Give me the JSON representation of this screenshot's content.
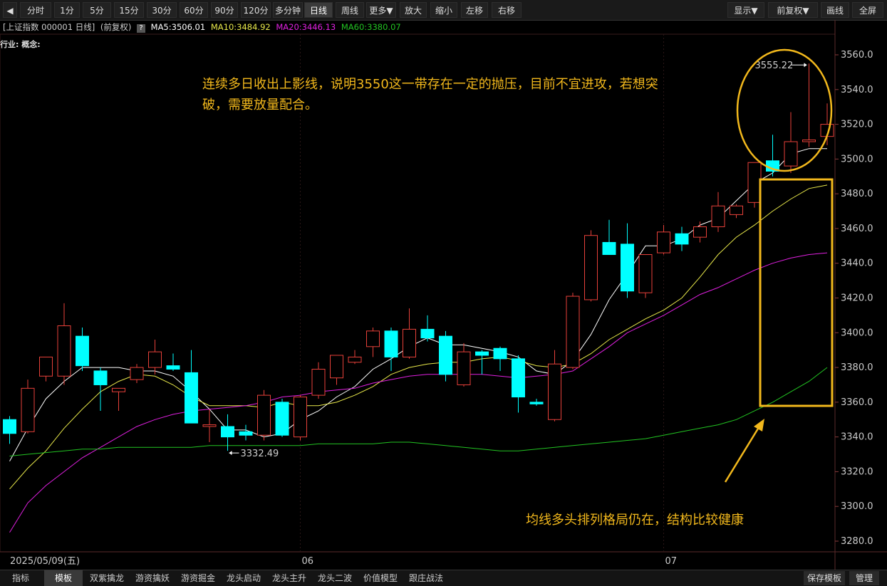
{
  "toolbar": {
    "collapse_icon": "◀",
    "periods": [
      "分时",
      "1分",
      "5分",
      "15分",
      "30分",
      "60分",
      "90分",
      "120分",
      "多分钟",
      "日线",
      "周线",
      "更多▼"
    ],
    "active_period": "日线",
    "zoom_in": "放大",
    "zoom_out": "缩小",
    "left": "左移",
    "right": "右移",
    "display": "显示▼",
    "adjust": "前复权▼",
    "draw": "画线",
    "fullscreen": "全屏"
  },
  "info": {
    "instrument": "[上证指数 000001 日线]",
    "adjust_mode": "(前复权)",
    "help_icon": "?",
    "ma5": "MA5:3506.01",
    "ma10": "MA10:3484.92",
    "ma20": "MA20:3446.13",
    "ma60": "MA60:3380.07",
    "industry": "行业: 概念:"
  },
  "colors": {
    "up": "#e8413a",
    "down": "#00ffff",
    "ma5": "#ffffff",
    "ma10": "#e8e84a",
    "ma20": "#e020e0",
    "ma60": "#22c422",
    "annotation": "#f2b81c",
    "grid": "#2a1a1a"
  },
  "chart_data": {
    "type": "candlestick",
    "ylim": [
      3280,
      3560
    ],
    "yticks": [
      "3560.0",
      "3540.0",
      "3520.0",
      "3500.0",
      "3480.0",
      "3460.0",
      "3440.0",
      "3420.0",
      "3400.0",
      "3380.0",
      "3360.0",
      "3340.0",
      "3320.0",
      "3300.0",
      "3280.0"
    ],
    "x_labels": [
      {
        "index": 0,
        "text": "2025/05/09(五)"
      },
      {
        "index": 16,
        "text": "06"
      },
      {
        "index": 36,
        "text": "07"
      }
    ],
    "candles": [
      {
        "o": 3350,
        "h": 3352,
        "l": 3336,
        "c": 3342
      },
      {
        "o": 3343,
        "h": 3373,
        "l": 3342,
        "c": 3368
      },
      {
        "o": 3375,
        "h": 3386,
        "l": 3372,
        "c": 3386
      },
      {
        "o": 3375,
        "h": 3417,
        "l": 3370,
        "c": 3404
      },
      {
        "o": 3398,
        "h": 3403,
        "l": 3378,
        "c": 3381
      },
      {
        "o": 3378,
        "h": 3380,
        "l": 3355,
        "c": 3370
      },
      {
        "o": 3366,
        "h": 3368,
        "l": 3355,
        "c": 3368
      },
      {
        "o": 3373,
        "h": 3382,
        "l": 3371,
        "c": 3380
      },
      {
        "o": 3380,
        "h": 3396,
        "l": 3376,
        "c": 3389
      },
      {
        "o": 3381,
        "h": 3388,
        "l": 3378,
        "c": 3379
      },
      {
        "o": 3377,
        "h": 3390,
        "l": 3348,
        "c": 3348
      },
      {
        "o": 3346,
        "h": 3356,
        "l": 3337,
        "c": 3347
      },
      {
        "o": 3346,
        "h": 3353,
        "l": 3332,
        "c": 3340
      },
      {
        "o": 3343,
        "h": 3347,
        "l": 3338,
        "c": 3341
      },
      {
        "o": 3341,
        "h": 3367,
        "l": 3338,
        "c": 3364
      },
      {
        "o": 3360,
        "h": 3362,
        "l": 3340,
        "c": 3341
      },
      {
        "o": 3340,
        "h": 3364,
        "l": 3338,
        "c": 3363
      },
      {
        "o": 3364,
        "h": 3383,
        "l": 3362,
        "c": 3379
      },
      {
        "o": 3374,
        "h": 3382,
        "l": 3370,
        "c": 3387
      },
      {
        "o": 3383,
        "h": 3390,
        "l": 3382,
        "c": 3386
      },
      {
        "o": 3392,
        "h": 3403,
        "l": 3386,
        "c": 3401
      },
      {
        "o": 3401,
        "h": 3403,
        "l": 3378,
        "c": 3386
      },
      {
        "o": 3386,
        "h": 3414,
        "l": 3385,
        "c": 3402
      },
      {
        "o": 3402,
        "h": 3410,
        "l": 3395,
        "c": 3397
      },
      {
        "o": 3398,
        "h": 3401,
        "l": 3372,
        "c": 3376
      },
      {
        "o": 3370,
        "h": 3394,
        "l": 3369,
        "c": 3389
      },
      {
        "o": 3389,
        "h": 3390,
        "l": 3376,
        "c": 3387
      },
      {
        "o": 3391,
        "h": 3392,
        "l": 3378,
        "c": 3385
      },
      {
        "o": 3385,
        "h": 3387,
        "l": 3354,
        "c": 3363
      },
      {
        "o": 3360,
        "h": 3362,
        "l": 3358,
        "c": 3359
      },
      {
        "o": 3350,
        "h": 3390,
        "l": 3349,
        "c": 3382
      },
      {
        "o": 3380,
        "h": 3423,
        "l": 3379,
        "c": 3421
      },
      {
        "o": 3419,
        "h": 3459,
        "l": 3418,
        "c": 3456
      },
      {
        "o": 3452,
        "h": 3465,
        "l": 3447,
        "c": 3445
      },
      {
        "o": 3451,
        "h": 3463,
        "l": 3420,
        "c": 3424
      },
      {
        "o": 3423,
        "h": 3445,
        "l": 3420,
        "c": 3445
      },
      {
        "o": 3446,
        "h": 3462,
        "l": 3445,
        "c": 3458
      },
      {
        "o": 3457,
        "h": 3461,
        "l": 3447,
        "c": 3451
      },
      {
        "o": 3455,
        "h": 3464,
        "l": 3452,
        "c": 3461
      },
      {
        "o": 3461,
        "h": 3481,
        "l": 3458,
        "c": 3473
      },
      {
        "o": 3468,
        "h": 3474,
        "l": 3466,
        "c": 3473
      },
      {
        "o": 3475,
        "h": 3498,
        "l": 3472,
        "c": 3498
      },
      {
        "o": 3499,
        "h": 3514,
        "l": 3490,
        "c": 3493
      },
      {
        "o": 3496,
        "h": 3527,
        "l": 3492,
        "c": 3510
      },
      {
        "o": 3510,
        "h": 3555,
        "l": 3507,
        "c": 3511
      },
      {
        "o": 3513,
        "h": 3532,
        "l": 3508,
        "c": 3520
      }
    ],
    "ma_series": [
      {
        "name": "MA5",
        "color_key": "ma5",
        "values": [
          3326,
          3345,
          3362,
          3372,
          3380,
          3380,
          3380,
          3378,
          3378,
          3375,
          3366,
          3356,
          3344,
          3344,
          3340,
          3342,
          3350,
          3355,
          3363,
          3369,
          3379,
          3385,
          3392,
          3397,
          3393,
          3393,
          3391,
          3389,
          3386,
          3378,
          3376,
          3384,
          3399,
          3419,
          3434,
          3450,
          3450,
          3454,
          3462,
          3466,
          3476,
          3486,
          3492,
          3503,
          3506,
          3506
        ]
      },
      {
        "name": "MA10",
        "color_key": "ma10",
        "values": [
          3310,
          3322,
          3332,
          3345,
          3356,
          3366,
          3372,
          3376,
          3375,
          3370,
          3363,
          3358,
          3358,
          3358,
          3357,
          3360,
          3358,
          3358,
          3360,
          3364,
          3369,
          3376,
          3380,
          3382,
          3383,
          3383,
          3385,
          3386,
          3384,
          3381,
          3380,
          3382,
          3388,
          3396,
          3402,
          3408,
          3413,
          3420,
          3432,
          3445,
          3455,
          3462,
          3470,
          3477,
          3483,
          3485
        ]
      },
      {
        "name": "MA20",
        "color_key": "ma20",
        "values": [
          3285,
          3302,
          3312,
          3320,
          3328,
          3334,
          3340,
          3346,
          3350,
          3353,
          3355,
          3356,
          3357,
          3358,
          3360,
          3363,
          3364,
          3366,
          3367,
          3368,
          3371,
          3373,
          3375,
          3376,
          3376,
          3376,
          3376,
          3375,
          3374,
          3375,
          3376,
          3378,
          3385,
          3392,
          3400,
          3405,
          3410,
          3416,
          3422,
          3426,
          3431,
          3436,
          3440,
          3443,
          3445,
          3446
        ]
      },
      {
        "name": "MA60",
        "color_key": "ma60",
        "values": [
          3329,
          3330,
          3331,
          3332,
          3333,
          3333,
          3334,
          3334,
          3334,
          3334,
          3334,
          3335,
          3335,
          3335,
          3335,
          3335,
          3335,
          3336,
          3336,
          3336,
          3336,
          3337,
          3337,
          3336,
          3335,
          3334,
          3333,
          3332,
          3332,
          3333,
          3334,
          3335,
          3336,
          3337,
          3338,
          3339,
          3341,
          3343,
          3345,
          3347,
          3350,
          3355,
          3360,
          3366,
          3372,
          3380
        ]
      }
    ],
    "annotations": {
      "high_label": "3555.22",
      "low_label": "3332.49",
      "text1_line1": "连续多日收出上影线，说明3550这一带存在一定的抛压，目前不宜进攻，若想突",
      "text1_line2": "破，需要放量配合。",
      "text2": "均线多头排列格局仍在，结构比较健康"
    }
  },
  "bottom": {
    "tabs": [
      "指标",
      "模板",
      "双紫擒龙",
      "游资擒妖",
      "游资掘金",
      "龙头启动",
      "龙头主升",
      "龙头二波",
      "价值模型",
      "跟庄战法"
    ],
    "active_tab": "模板",
    "save_template": "保存模板",
    "manage": "管理"
  }
}
